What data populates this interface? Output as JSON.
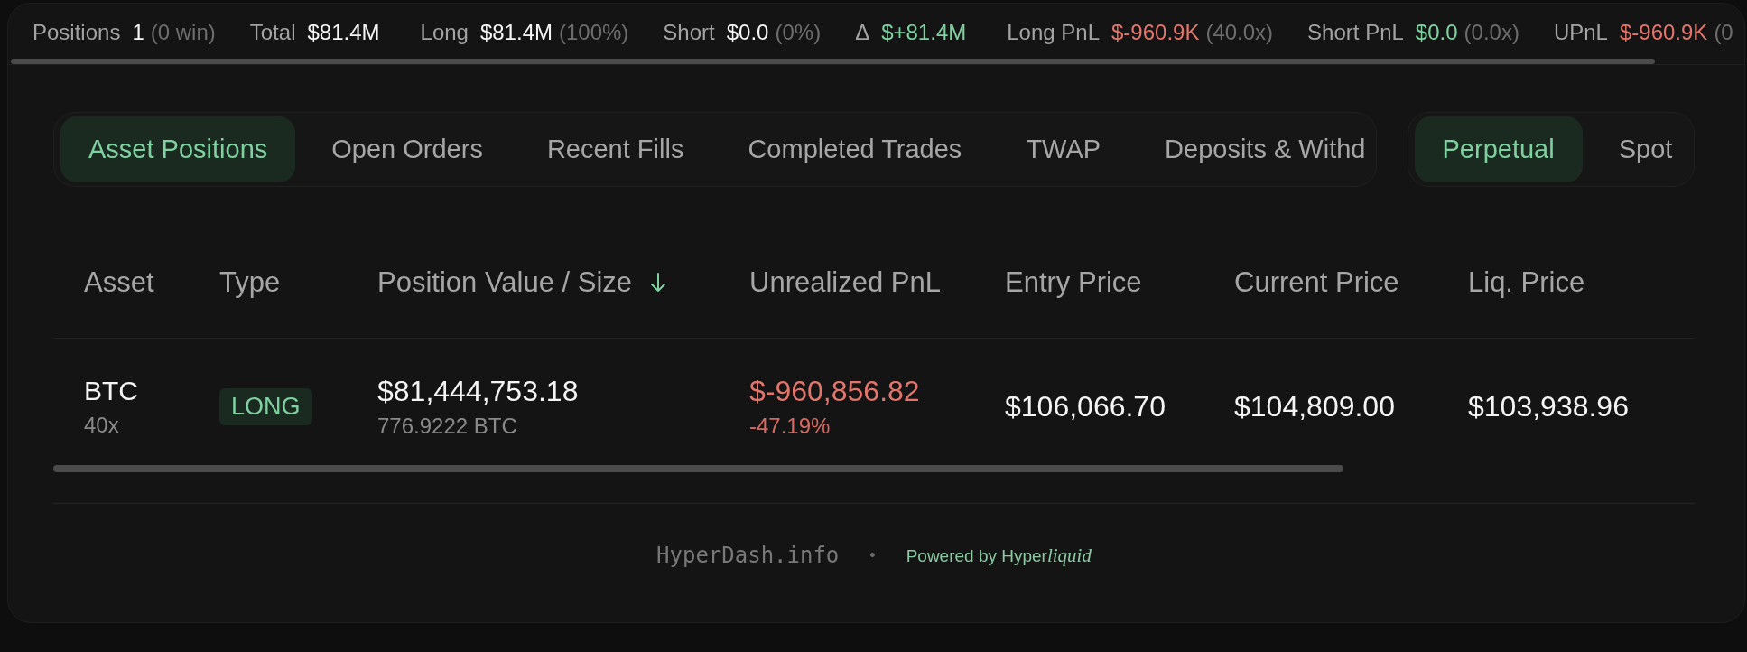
{
  "stats_bar": {
    "items": [
      {
        "label": "Positions",
        "value": "1",
        "detail": "(0 win)"
      },
      {
        "label": "Total",
        "value": "$81.4M"
      },
      {
        "label": "Long",
        "value": "$81.4M",
        "detail": "(100%)"
      },
      {
        "label": "Short",
        "value": "$0.0",
        "detail": "(0%)"
      },
      {
        "label": "Δ",
        "value": "$+81.4M",
        "color": "#7fd1a0"
      },
      {
        "label": "Long PnL",
        "value": "$-960.9K",
        "detail": "(40.0x)",
        "color": "#e2756c"
      },
      {
        "label": "Short PnL",
        "value": "$0.0",
        "detail": "(0.0x)",
        "color": "#7fd1a0"
      },
      {
        "label": "UPnL",
        "value": "$-960.9K",
        "detail": "(0",
        "color": "#e2756c"
      }
    ]
  },
  "view_tabs": [
    {
      "label": "Asset Positions",
      "selected": true
    },
    {
      "label": "Open Orders",
      "selected": false
    },
    {
      "label": "Recent Fills",
      "selected": false
    },
    {
      "label": "Completed Trades",
      "selected": false
    },
    {
      "label": "TWAP",
      "selected": false
    },
    {
      "label": "Deposits & Withd",
      "selected": false
    }
  ],
  "market_tabs": [
    {
      "label": "Perpetual",
      "selected": true
    },
    {
      "label": "Spot",
      "selected": false
    }
  ],
  "table": {
    "columns": [
      {
        "label": "Asset",
        "sorted": false
      },
      {
        "label": "Type",
        "sorted": false
      },
      {
        "label": "Position Value / Size",
        "sorted": true
      },
      {
        "label": "Unrealized PnL",
        "sorted": false
      },
      {
        "label": "Entry Price",
        "sorted": false
      },
      {
        "label": "Current Price",
        "sorted": false
      },
      {
        "label": "Liq. Price",
        "sorted": false
      }
    ],
    "rows": [
      {
        "asset": "BTC",
        "leverage": "40x",
        "type": "LONG",
        "position_value": "$81,444,753.18",
        "size": "776.9222 BTC",
        "unrealized_pnl": "$-960,856.82",
        "pnl_percent": "-47.19%",
        "pnl_negative": true,
        "entry_price": "$106,066.70",
        "current_price": "$104,809.00",
        "liq_price": "$103,938.96"
      }
    ]
  },
  "footer": {
    "site": "HyperDash.info",
    "separator": "•",
    "powered_by": {
      "text": "Powered by",
      "brand": "Hyper",
      "brand_italic": "liquid"
    }
  }
}
